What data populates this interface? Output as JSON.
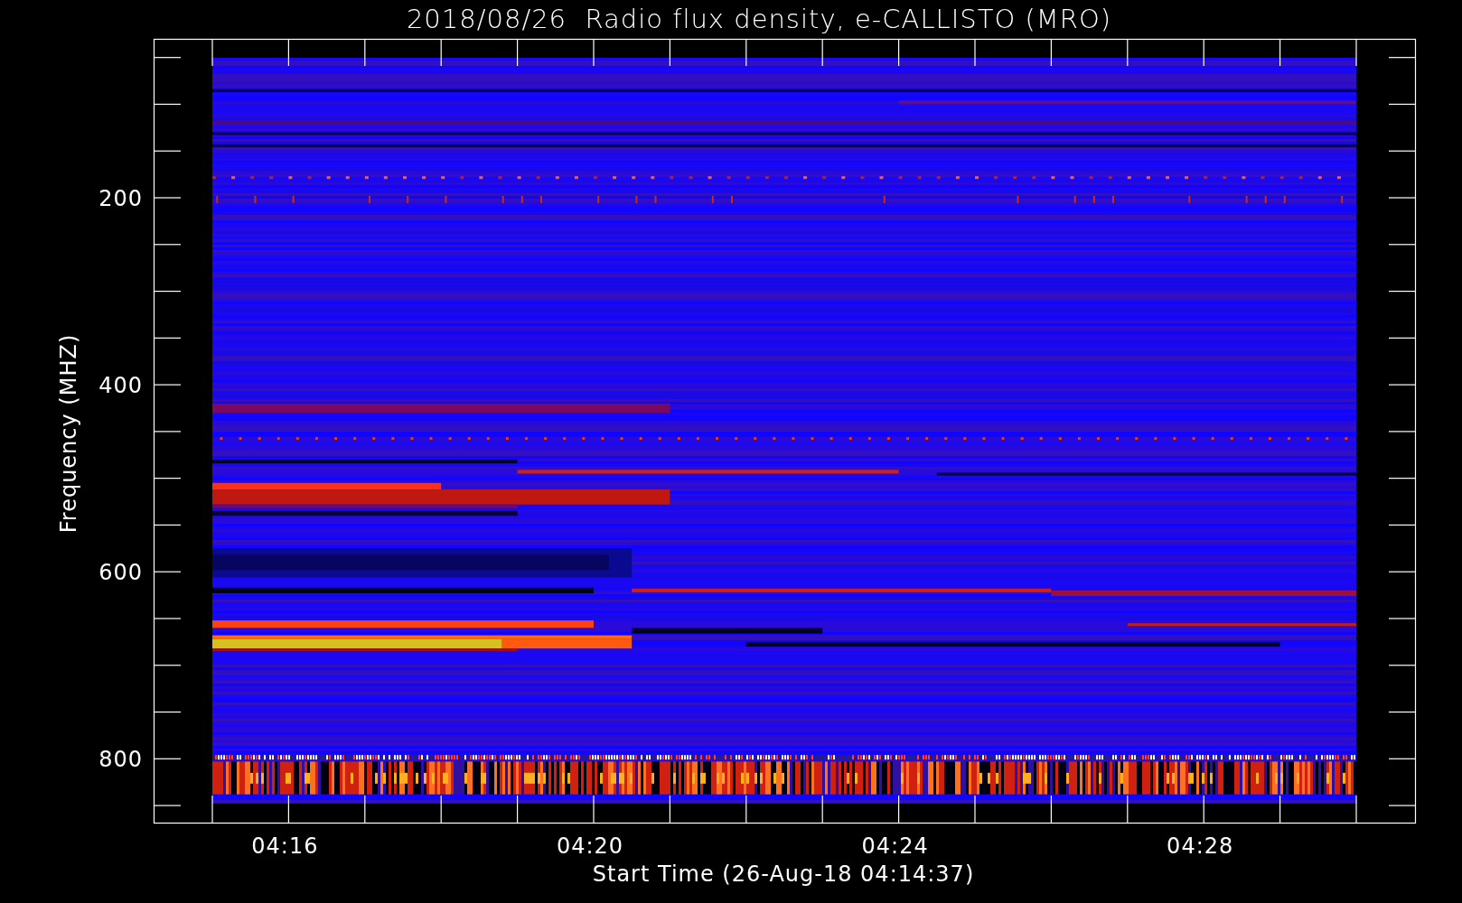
{
  "title": "2018/08/26  Radio flux density, e-CALLISTO (MRO)",
  "y_axis": {
    "label": "Frequency (MHZ)",
    "tick_labels": [
      "200",
      "400",
      "600",
      "800"
    ]
  },
  "x_axis": {
    "label": "Start Time (26-Aug-18 04:14:37)",
    "tick_labels": [
      "04:16",
      "04:20",
      "04:24",
      "04:28"
    ]
  }
}
